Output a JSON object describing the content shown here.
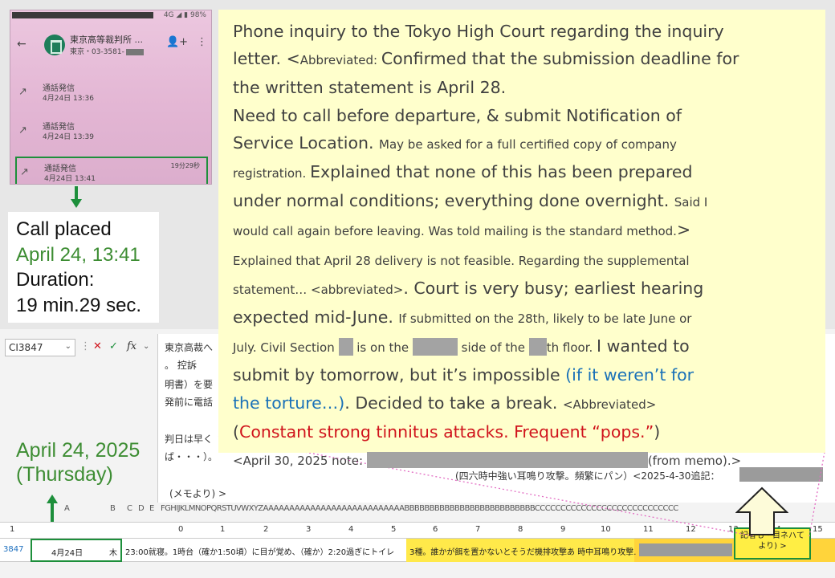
{
  "phone": {
    "status_text": "4G ◢ ▮ 98%",
    "back_icon": "←",
    "contact_name": "東京高等裁判所 ...",
    "contact_sub": "東京・03-3581-",
    "add_person_icon": "person-add-icon",
    "more_icon": "more-vert-icon",
    "calls": [
      {
        "label": "通話発信",
        "time": "4月24日 13:36",
        "duration": ""
      },
      {
        "label": "通話発信",
        "time": "4月24日 13:39",
        "duration": ""
      },
      {
        "label": "通話発信",
        "time": "4月24日 13:41",
        "duration": "19分29秒"
      }
    ]
  },
  "call_box": {
    "line1": "Call placed",
    "line2": "April 24, 13:41",
    "line3": "Duration:",
    "line4": "19 min.29 sec."
  },
  "date_label": {
    "line1": "April 24, 2025",
    "line2": "(Thursday)"
  },
  "note": {
    "l1": "Phone inquiry to the Tokyo High Court regarding the inquiry",
    "l2a": "letter. <",
    "l2b": "Abbreviated: ",
    "l2c": "Confirmed that the submission deadline for",
    "l3": "the written statement is April 28.",
    "l4": "Need to call before departure, & submit Notification of",
    "l5a": "Service Location. ",
    "l5b": "May be asked for a full certified copy of company",
    "l6a": "registration. ",
    "l6b": "Explained that none of this has been prepared",
    "l7a": "under normal conditions; everything done overnight. ",
    "l7b": "Said I",
    "l8a": "would call again before leaving. Was told mailing is the standard method.",
    "l8b": ">",
    "l9": "Explained that April 28 delivery is not feasible. Regarding the supplemental",
    "l10a": "statement… <abbreviated>",
    "l10b": ". Court is very busy; earliest hearing",
    "l11a": "expected mid-June. ",
    "l11b": "If submitted on the 28th, likely to be late June or",
    "l12a": "July. Civil Section ",
    "l12b": " is on the ",
    "l12c": " side of the ",
    "l12d": "th floor. ",
    "l12e": "I wanted to",
    "l13a": "submit by tomorrow, but it’s impossible ",
    "l13b": "(if it weren’t for",
    "l14a": "the torture…)",
    "l14b": ". Decided to take a break. ",
    "l14c": "<Abbreviated>",
    "l15a": "(",
    "l15b": "Constant strong tinnitus attacks. Frequent “pops.”",
    "l15c": ")",
    "l16a": "<April 30, 2025 note: ",
    "l16b": "(from memo).>"
  },
  "sheet": {
    "namebox": "CI3847",
    "fx_icons": {
      "cancel": "✕",
      "enter": "✓",
      "fx": "fx"
    },
    "formula_lines": [
      "東京高裁へ",
      "。 控訴",
      "明書）を要",
      "発前に電話",
      "",
      "判日は早く",
      "ば・・・）。",
      "(四六時中強い耳鳴り攻撃。頻繁にパン）<2025-4-30追記：",
      "(メモより) >"
    ],
    "col_letters": [
      "A",
      "B",
      "C",
      "D",
      "E",
      "FGHIJKLMNOPQRSTUVWXYZAAAAAAAAAAAAAAAAAAAAAAAAAAABBBBBBBBBBBBBBBBBBBBBBBBBBCCCCCCCCCCCCCCCCCCCCCCCCCCCC"
    ],
    "num_row": [
      "0",
      "1",
      "2",
      "3",
      "4",
      "5",
      "6",
      "7",
      "8",
      "9",
      "10",
      "11",
      "12",
      "13",
      "14",
      "15"
    ],
    "row_number": "3847",
    "row_header": "1",
    "date_cell": "4月24日",
    "weekday_cell": "木",
    "row_text": "23:00就寝。1時台（確か1:50頃）に目が覚め、（確か）2:20過ぎにトイレ",
    "row_text2": "3種。誰かが餌を置かないとそうだ機排攻撃あ 時中耳鳴り攻撃.",
    "green_box_text": "記者も・目ネハて\nより) >"
  }
}
